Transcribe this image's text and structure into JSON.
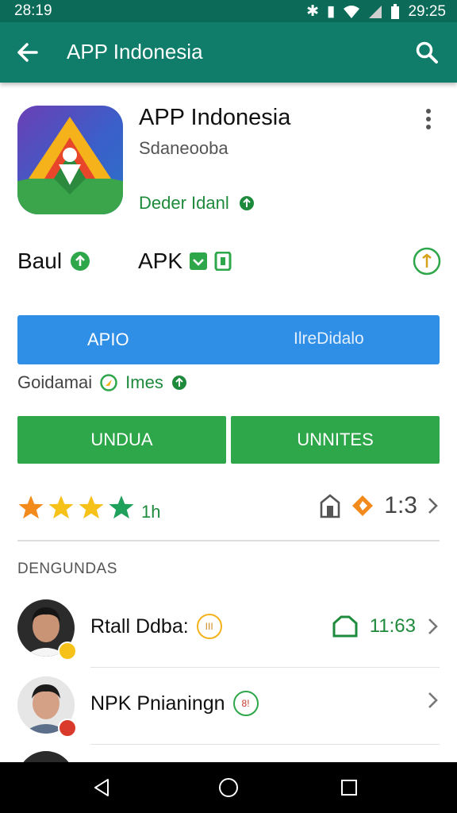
{
  "status": {
    "time_left": "28:19",
    "time_right": "29:25"
  },
  "appbar": {
    "title": "APP Indonesia"
  },
  "app": {
    "title": "APP Indonesia",
    "subtitle": "Sdaneooba",
    "developer": "Deder Idanl"
  },
  "labels": {
    "bauli": "Baul",
    "apk": "APK"
  },
  "blue_bar": {
    "left": "APIO",
    "right": "IlreDidalo"
  },
  "info": {
    "left": "Goidamai",
    "right": "Imes"
  },
  "buttons": {
    "left": "UNDUA",
    "right": "UNNITES"
  },
  "rating": {
    "stars": 4,
    "count": "1h",
    "value": "1:3"
  },
  "section_title": "DENGUNDAS",
  "people": [
    {
      "name": "Rtall Ddba:",
      "badge": "III",
      "value": "11:63"
    },
    {
      "name": "NPK Pnianingn",
      "badge": "8!"
    }
  ],
  "colors": {
    "appbar": "#0f7d69",
    "status": "#0b6b58",
    "blue": "#2f8ee6",
    "green": "#2ea64a",
    "accent_green": "#1e8a3c",
    "star_orange": "#f28a1c",
    "star_yellow": "#f6c21a",
    "star_green": "#1fa05b"
  },
  "icons": [
    "back-arrow-icon",
    "search-icon",
    "more-vert-icon",
    "check-icon",
    "download-icon",
    "star-icon",
    "share-icon",
    "tag-icon",
    "chevron-right-icon",
    "nav-back-icon",
    "nav-home-icon",
    "nav-recents-icon"
  ]
}
